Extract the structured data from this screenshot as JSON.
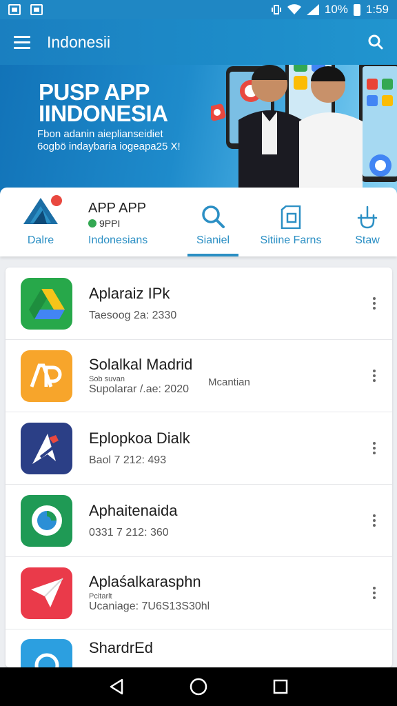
{
  "status_bar": {
    "battery": "10%",
    "time": "1:59"
  },
  "header": {
    "title": "Indonesii"
  },
  "banner": {
    "title_line1": "PUSP APP",
    "title_line2": "IINDONESIA",
    "subtitle_line1": "Fbon adanin aieplianseidiet",
    "subtitle_line2": "6ogbö indaybaria iogeapa25 X!"
  },
  "tabs": [
    {
      "label": "Dalre"
    },
    {
      "title": "APP APP",
      "sub": "9PPI",
      "label": "Indonesians"
    },
    {
      "label": "Sianiel"
    },
    {
      "label": "Sitiine Farns"
    },
    {
      "label": "Staw"
    }
  ],
  "apps": [
    {
      "name": "Aplaraiz IPk",
      "meta": "Taesoog 2a: 2330"
    },
    {
      "name": "Solalkal Madrid",
      "small": "Sob suvan",
      "meta": "Supolarar /.ae: 2020",
      "extra": "Mcantian"
    },
    {
      "name": "Eplopkoa Dialk",
      "meta": "Baol 7 212: 493"
    },
    {
      "name": "Aphaitenaida",
      "meta": "0331 7 212: 360"
    },
    {
      "name": "Aplaśalkarasphn",
      "small": "Pcitarlt",
      "meta": "Ucaniage: 7U6S13S30hl"
    },
    {
      "name": "ShardrEd"
    }
  ],
  "colors": {
    "accent": "#2b8fc4",
    "header": "#1d86c6"
  },
  "nav": {
    "back_icon": "triangle-back",
    "home_icon": "circle-home",
    "recents_icon": "square-recents"
  }
}
